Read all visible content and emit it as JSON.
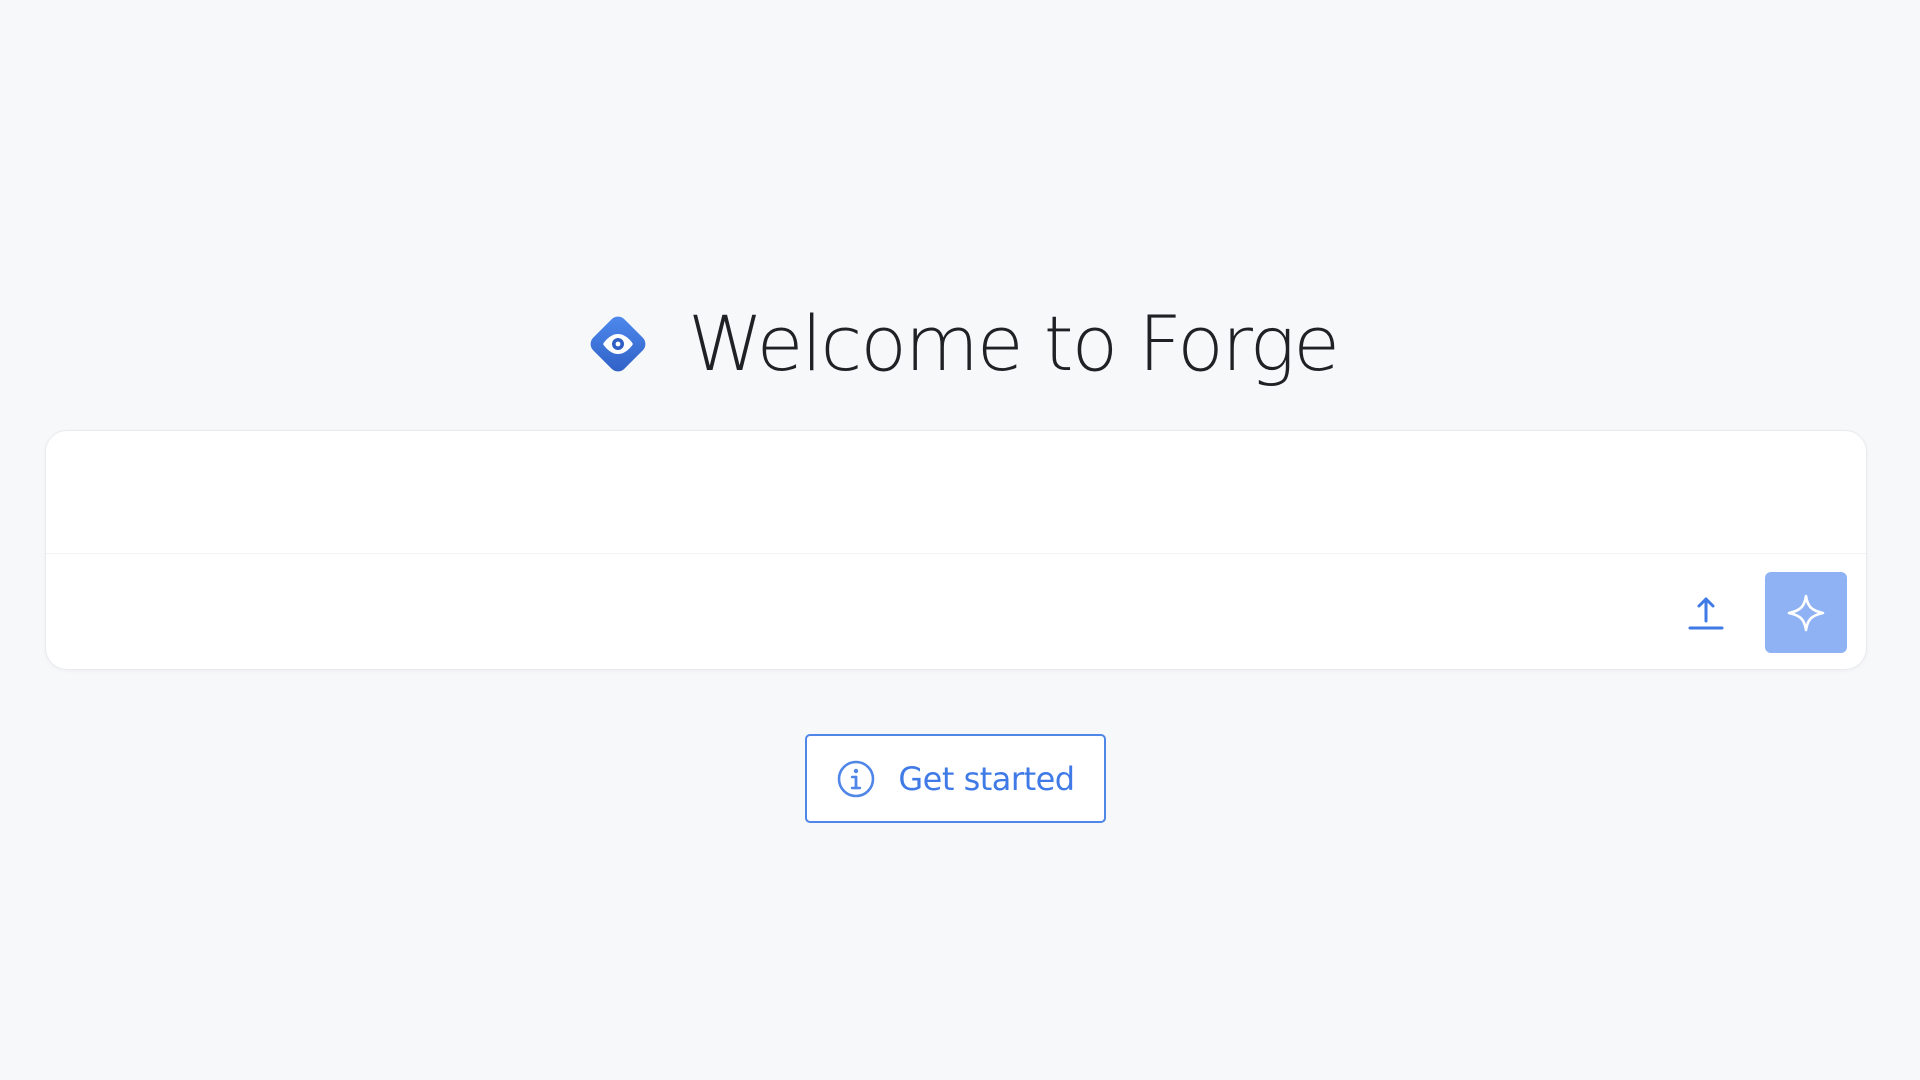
{
  "header": {
    "title": "Welcome to Forge",
    "logo_icon": "eye-diamond-icon"
  },
  "composer": {
    "prompt_value": "",
    "upload_icon": "upload-icon",
    "generate_icon": "sparkle-icon"
  },
  "actions": {
    "get_started_label": "Get started",
    "get_started_icon": "info-icon"
  },
  "colors": {
    "background": "#f7f8fa",
    "accent": "#4f86e8",
    "generate_button": "#8fb2f4",
    "title_text": "#1f2125"
  }
}
